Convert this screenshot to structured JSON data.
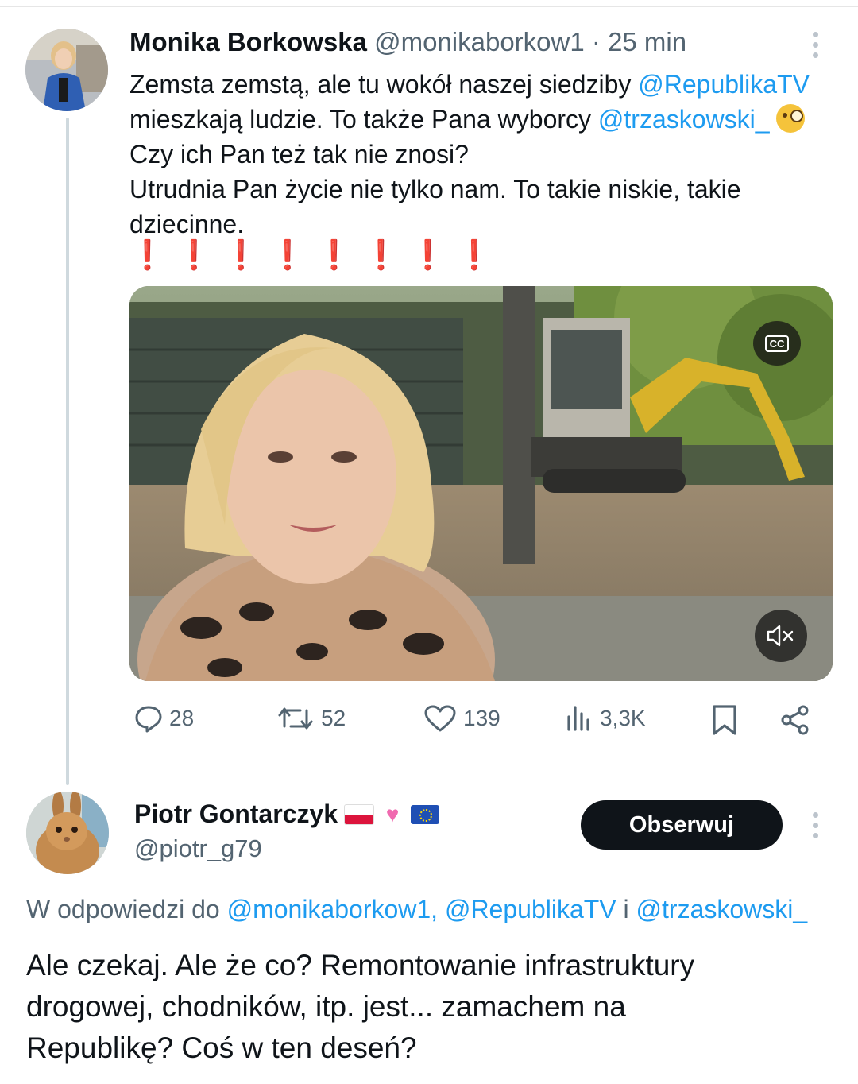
{
  "tweet1": {
    "author_name": "Monika Borkowska",
    "handle": "@monikaborkow1",
    "separator": "·",
    "time": "25 min",
    "text": {
      "line1_prefix": "Zemsta zemstą, ale tu wokół naszej siedziby ",
      "line1_link": "@RepublikaTV",
      "line2_prefix": "mieszkają ludzie. To także Pana wyborcy ",
      "line2_link": "@trzaskowski_",
      "line3": "Czy ich Pan też tak nie znosi?",
      "line4": "Utrudnia Pan życie nie tylko nam. To takie niskie, takie",
      "line5": "dziecinne."
    },
    "exclamations": "❗❗❗❗❗❗❗❗",
    "video": {
      "cc_label": "CC",
      "mute_icon": "speaker-muted-icon"
    },
    "actions": {
      "replies": "28",
      "retweets": "52",
      "likes": "139",
      "views": "3,3K"
    }
  },
  "tweet2": {
    "author_name": "Piotr Gontarczyk",
    "handle": "@piotr_g79",
    "follow_label": "Obserwuj",
    "reply_to": {
      "prefix": "W odpowiedzi do ",
      "mention1": "@monikaborkow1,",
      "mention2": "@RepublikaTV",
      "conj": " i ",
      "mention3": "@trzaskowski_"
    },
    "text": {
      "line1": "Ale czekaj. Ale że co? Remontowanie infrastruktury",
      "line2": "drogowej, chodników, itp. jest... zamachem na",
      "line3": "Republikę? Coś w ten deseń?"
    }
  },
  "colors": {
    "link": "#1d9bf0",
    "secondary_text": "#536471",
    "button_bg": "#0f1419",
    "exclamation": "#e0223a"
  }
}
